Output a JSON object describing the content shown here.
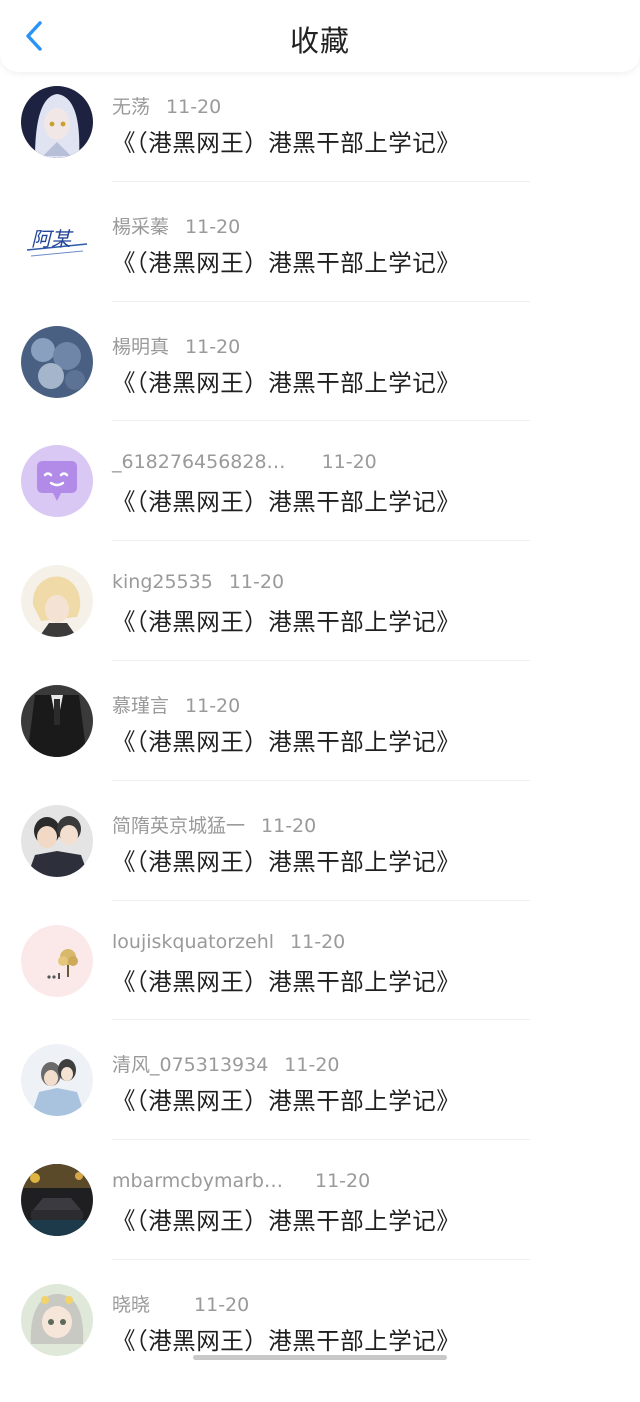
{
  "header": {
    "title": "收藏",
    "back_icon": "chevron-left-icon",
    "accent": "#2a93f4"
  },
  "items": [
    {
      "name": "无荡",
      "date": "11-20",
      "book": "《（港黑网王）港黑干部上学记》",
      "avatar_icon": "anime-girl-avatar"
    },
    {
      "name": "楊采蓁",
      "date": "11-20",
      "book": "《（港黑网王）港黑干部上学记》",
      "avatar_icon": "signature-avatar",
      "avatar_text": "阿某"
    },
    {
      "name": "楊明真",
      "date": "11-20",
      "book": "《（港黑网王）港黑干部上学记》",
      "avatar_icon": "flowers-avatar"
    },
    {
      "name": "_618276456828…",
      "date": "11-20",
      "book": "《（港黑网王）港黑干部上学记》",
      "avatar_icon": "chat-bubble-avatar"
    },
    {
      "name": "king25535",
      "date": "11-20",
      "book": "《（港黑网王）港黑干部上学记》",
      "avatar_icon": "anime-boy-avatar"
    },
    {
      "name": "慕瑾言",
      "date": "11-20",
      "book": "《（港黑网王）港黑干部上学记》",
      "avatar_icon": "suit-avatar"
    },
    {
      "name": "简隋英京城猛一",
      "date": "11-20",
      "book": "《（港黑网王）港黑干部上学记》",
      "avatar_icon": "two-men-avatar"
    },
    {
      "name": "loujiskquatorzehl",
      "date": "11-20",
      "book": "《（港黑网王）港黑干部上学记》",
      "avatar_icon": "tree-avatar"
    },
    {
      "name": "清风_075313934",
      "date": "11-20",
      "book": "《（港黑网王）港黑干部上学记》",
      "avatar_icon": "couple-avatar"
    },
    {
      "name": "mbarmcbymarb…",
      "date": "11-20",
      "book": "《（港黑网王）港黑干部上学记》",
      "avatar_icon": "car-avatar"
    },
    {
      "name": "晓晓",
      "date": "11-20",
      "book": "《（港黑网王）港黑干部上学记》",
      "avatar_icon": "chibi-girl-avatar"
    }
  ]
}
